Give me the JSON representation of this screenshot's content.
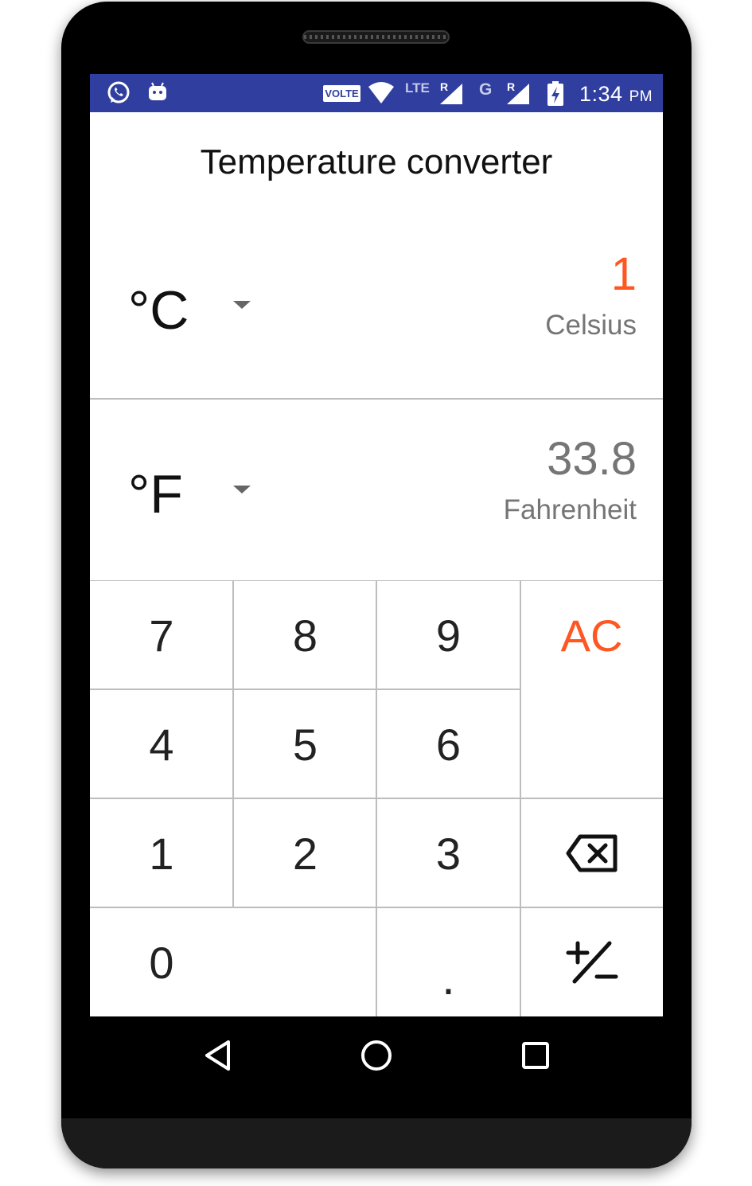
{
  "status_bar": {
    "time": "1:34",
    "ampm": "PM",
    "volte": "VOLTE",
    "network_lte": "LTE",
    "network_g": "G",
    "roaming_1": "R",
    "roaming_2": "R"
  },
  "app": {
    "title": "Temperature converter"
  },
  "input": {
    "unit_symbol": "°C",
    "value": "1",
    "unit_name": "Celsius"
  },
  "output": {
    "unit_symbol": "°F",
    "value": "33.8",
    "unit_name": "Fahrenheit"
  },
  "keypad": {
    "k7": "7",
    "k8": "8",
    "k9": "9",
    "clear": "AC",
    "k4": "4",
    "k5": "5",
    "k6": "6",
    "k1": "1",
    "k2": "2",
    "k3": "3",
    "k0": "0",
    "dot": ".",
    "backspace_icon": "backspace-icon",
    "plus_minus_icon": "plus-minus-icon"
  },
  "colors": {
    "status_bar": "#303f9f",
    "accent": "#ff5722",
    "divider": "#bdbdbd",
    "secondary_text": "#757575"
  }
}
